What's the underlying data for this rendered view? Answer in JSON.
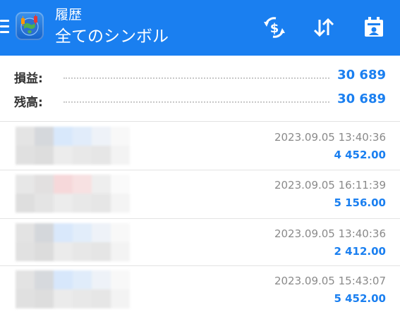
{
  "header": {
    "title": "履歴",
    "subtitle": "全てのシンボル",
    "menu_icon": "hamburger-menu-icon",
    "deposit_icon": "dollar-refresh-icon",
    "sort_icon": "sort-arrows-icon",
    "calendar_icon": "calendar-icon",
    "colors": {
      "bar": "#1a7ff0",
      "text": "#ffffff"
    }
  },
  "summary": {
    "profit_label": "損益:",
    "profit_value": "30 689",
    "balance_label": "残高:",
    "balance_value": "30 689"
  },
  "deals": [
    {
      "time": "2023.09.05 13:40:36",
      "profit": "4 452.00"
    },
    {
      "time": "2023.09.05 16:11:39",
      "profit": "5 156.00"
    },
    {
      "time": "2023.09.05 13:40:36",
      "profit": "2 412.00"
    },
    {
      "time": "2023.09.05 15:43:07",
      "profit": "5 452.00"
    }
  ],
  "colors": {
    "accent": "#1a7ff0",
    "muted_text": "#8a8a8a"
  }
}
